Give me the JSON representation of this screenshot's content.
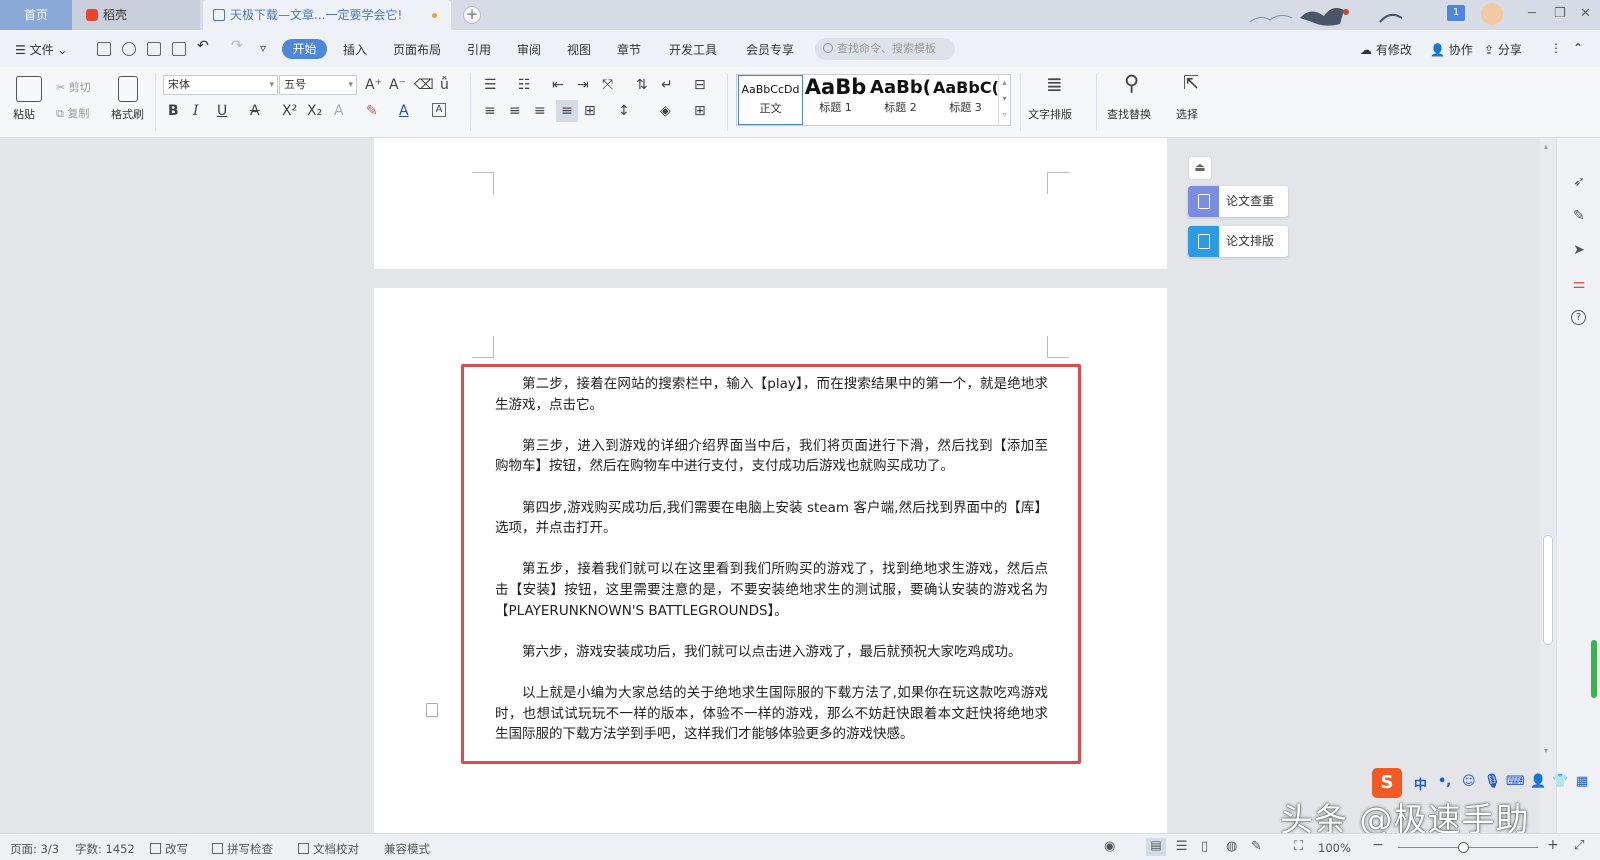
{
  "tabs": {
    "home": "首页",
    "daoke": "稻壳",
    "document": "天极下载—文章...一定要学会它!",
    "page_badge": "1"
  },
  "menubar": {
    "file": "文件",
    "items": [
      "开始",
      "插入",
      "页面布局",
      "引用",
      "审阅",
      "视图",
      "章节",
      "开发工具",
      "会员专享"
    ],
    "search_placeholder": "查找命令、搜索模板",
    "modified": "有修改",
    "collaborate": "协作",
    "share": "分享"
  },
  "ribbon": {
    "paste": "粘贴",
    "cut": "剪切",
    "copy": "复制",
    "format_painter": "格式刷",
    "font_name": "宋体",
    "font_size": "五号",
    "styles": [
      {
        "sample": "AaBbCcDd",
        "name": "正文"
      },
      {
        "sample": "AaBb",
        "name": "标题 1"
      },
      {
        "sample": "AaBb(",
        "name": "标题 2"
      },
      {
        "sample": "AaBbC(",
        "name": "标题 3"
      }
    ],
    "text_layout": "文字排版",
    "find_replace": "查找替换",
    "select": "选择"
  },
  "document": {
    "paragraphs": [
      "第二步，接着在网站的搜索栏中，输入【play】，而在搜索结果中的第一个，就是绝地求生游戏，点击它。",
      "第三步，进入到游戏的详细介绍界面当中后，我们将页面进行下滑，然后找到【添加至购物车】按钮，然后在购物车中进行支付，支付成功后游戏也就购买成功了。",
      "第四步,游戏购买成功后,我们需要在电脑上安装 steam 客户端,然后找到界面中的【库】选项，并点击打开。",
      "第五步，接着我们就可以在这里看到我们所购买的游戏了，找到绝地求生游戏，然后点击【安装】按钮，这里需要注意的是，不要安装绝地求生的测试服，要确认安装的游戏名为【PLAYERUNKNOWN'S BATTLEGROUNDS】。",
      "第六步，游戏安装成功后，我们就可以点击进入游戏了，最后就预祝大家吃鸡成功。",
      "以上就是小编为大家总结的关于绝地求生国际服的下载方法了,如果你在玩这款吃鸡游戏时，也想试试玩玩不一样的版本，体验不一样的游戏，那么不妨赶快跟着本文赶快将绝地求生国际服的下载方法学到手吧，这样我们才能够体验更多的游戏快感。"
    ]
  },
  "side_panel": {
    "paper_check": "论文查重",
    "paper_layout": "论文排版"
  },
  "statusbar": {
    "page": "页面: 3/3",
    "words": "字数: 1452",
    "overwrite": "改写",
    "spell_check": "拼写检查",
    "proofread": "文档校对",
    "compat": "兼容模式",
    "zoom": "100%"
  },
  "ime": {
    "lang": "中"
  },
  "watermark": "头条 @极速手助",
  "colors": {
    "accent": "#4e86d8",
    "highlight": "#e04a4a"
  }
}
